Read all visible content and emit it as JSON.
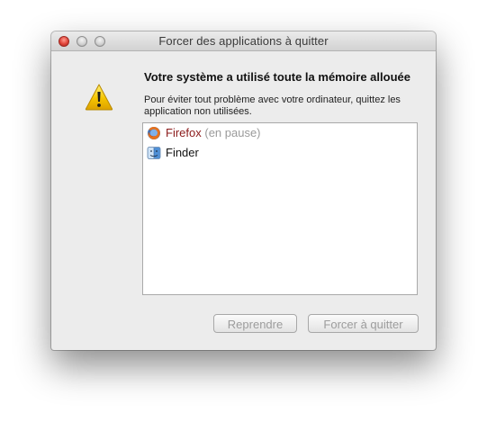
{
  "window": {
    "title": "Forcer des applications à quitter"
  },
  "alert": {
    "icon": "warning-icon",
    "heading": "Votre système a utilisé toute la mémoire allouée",
    "description": "Pour éviter tout problème avec votre ordinateur, quittez les application non utilisées."
  },
  "apps": [
    {
      "name": "Firefox",
      "status": "(en pause)",
      "icon": "firefox-icon"
    },
    {
      "name": "Finder",
      "status": "",
      "icon": "finder-icon"
    }
  ],
  "buttons": {
    "resume_label": "Reprendre",
    "force_quit_label": "Forcer à quitter"
  },
  "colors": {
    "paused_app_name": "#8b1a1a",
    "paused_status": "#9a9a9a",
    "close_button": "#e0443a",
    "warning": "#f5c400"
  }
}
